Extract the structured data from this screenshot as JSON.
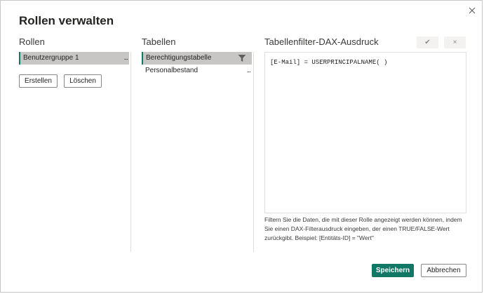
{
  "dialog": {
    "title": "Rollen verwalten",
    "close_icon": "close-icon"
  },
  "roles": {
    "heading": "Rollen",
    "items": [
      {
        "label": "Benutzergruppe 1",
        "selected": true
      }
    ],
    "more_label": "...",
    "create_label": "Erstellen",
    "delete_label": "Löschen"
  },
  "tables": {
    "heading": "Tabellen",
    "items": [
      {
        "label": "Berechtigungstabelle",
        "selected": true,
        "icon": "filter-icon"
      },
      {
        "label": "Personalbestand",
        "selected": false
      }
    ],
    "more_label": "..."
  },
  "dax": {
    "heading": "Tabellenfilter-DAX-Ausdruck",
    "apply_icon": "checkmark-icon",
    "cancel_icon": "x-icon",
    "apply_glyph": "✔",
    "cancel_glyph": "×",
    "expression": "[E-Mail] = USERPRINCIPALNAME( )",
    "hint": "Filtern Sie die Daten, die mit dieser Rolle angezeigt werden können, indem Sie einen DAX-Filterausdruck eingeben, der einen TRUE/FALSE-Wert zurückgibt. Beispiel: [Entitäts-ID] = \"Wert\""
  },
  "footer": {
    "save_label": "Speichern",
    "cancel_label": "Abbrechen"
  },
  "colors": {
    "accent": "#117865",
    "selection": "#c8c6c4"
  }
}
